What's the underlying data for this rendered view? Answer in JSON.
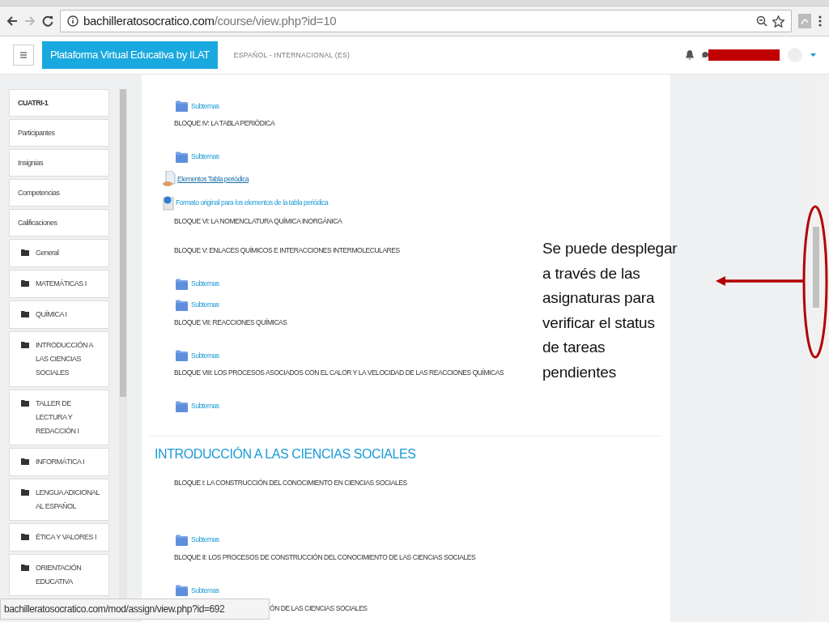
{
  "browser": {
    "address": {
      "host": "bachilleratosocratico.com",
      "path": "/course/view.php?id=10"
    }
  },
  "navbar": {
    "brand": "Plataforma Virtual Educativa by ILAT",
    "language": "ESPAÑOL - INTERNACIONAL (ES)"
  },
  "sidebar": {
    "items": [
      {
        "kind": "title",
        "label": "CUATRI-1"
      },
      {
        "kind": "link",
        "label": "Participantes"
      },
      {
        "kind": "link",
        "label": "Insignias"
      },
      {
        "kind": "link",
        "label": "Competencias"
      },
      {
        "kind": "link",
        "label": "Calificaciones"
      },
      {
        "kind": "folder",
        "label": "General"
      },
      {
        "kind": "folder",
        "label": "MATEMÁTICAS I"
      },
      {
        "kind": "folder",
        "label": "QUÍMICA I"
      },
      {
        "kind": "folder",
        "label": "INTRODUCCIÓN A LAS CIENCIAS SOCIALES"
      },
      {
        "kind": "folder",
        "label": "TALLER DE LECTURA Y REDACCIÓN I"
      },
      {
        "kind": "folder",
        "label": "INFORMÁTICA I"
      },
      {
        "kind": "folder",
        "label": "LENGUA ADICIONAL AL ESPAÑOL"
      },
      {
        "kind": "folder",
        "label": "ÉTICA Y VALORES I"
      },
      {
        "kind": "folder",
        "label": "ORIENTACIÓN EDUCATIVA"
      }
    ]
  },
  "content": {
    "items": [
      {
        "kind": "folder",
        "text": "Subtemas"
      },
      {
        "kind": "block",
        "text": "BLOQUE IV: LA TABLA PERIÓDICA"
      },
      {
        "kind": "folder",
        "text": "Subtemas"
      },
      {
        "kind": "file",
        "text": "Elementos Tabla periódica"
      },
      {
        "kind": "url",
        "text": "Formato original para los elementos de la tabla periódica"
      },
      {
        "kind": "block",
        "text": "BLOQUE VI: LA NOMENCLATURA QUÍMICA INORGÁNICA"
      },
      {
        "kind": "block",
        "text": "BLOQUE V: ENLACES QUÍMICOS E INTERACCIONES INTERMOLECULARES"
      },
      {
        "kind": "folder",
        "text": "Subtemas"
      },
      {
        "kind": "folder",
        "text": "Subtemas"
      },
      {
        "kind": "block",
        "text": "BLOQUE VII: REACCIONES QUÍMICAS"
      },
      {
        "kind": "folder",
        "text": "Subtemas"
      },
      {
        "kind": "block",
        "text": "BLOQUE VIII: LOS PROCESOS ASOCIADOS CON EL CALOR Y LA VELOCIDAD DE LAS REACCIONES QUÍMICAS"
      },
      {
        "kind": "folder",
        "text": "Subtemas"
      },
      {
        "kind": "section",
        "text": "INTRODUCCIÓN A LAS CIENCIAS SOCIALES"
      },
      {
        "kind": "block_spaced",
        "text": "BLOQUE I: LA CONSTRUCCIÓN DEL CONOCIMIENTO EN CIENCIAS SOCIALES"
      },
      {
        "kind": "folder",
        "text": "Subtemas"
      },
      {
        "kind": "block",
        "text": "BLOQUE II: LOS PROCESOS DE  CONSTRUCCIÓN DEL CONOCIMIENTO DE LAS  CIENCIAS SOCIALES"
      },
      {
        "kind": "folder",
        "text": "Subtemas"
      },
      {
        "kind": "partial",
        "text": "ÓN DE LAS CIENCIAS SOCIALES"
      }
    ]
  },
  "annotation": {
    "lines": [
      "Se puede desplegar",
      "a través de las",
      "asignaturas para",
      "verificar el status",
      "de tareas",
      "pendientes"
    ]
  },
  "status_bar": {
    "url": "bachilleratosocratico.com/mod/assign/view.php?id=692"
  }
}
